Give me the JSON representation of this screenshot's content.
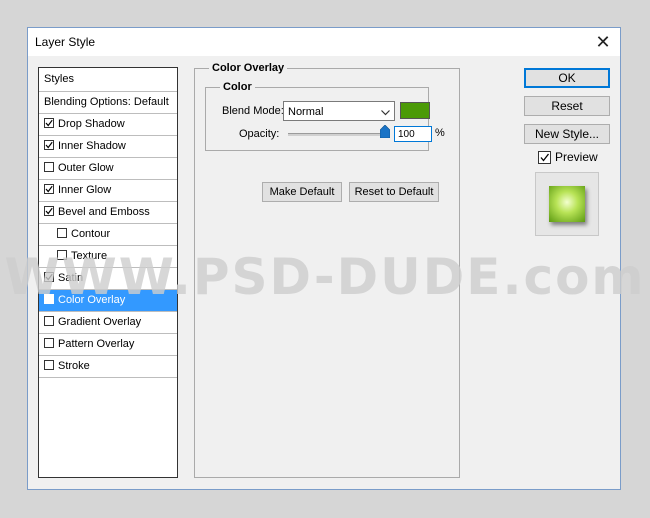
{
  "window": {
    "title": "Layer Style",
    "close_glyph": "✕"
  },
  "styles_header": "Styles",
  "blending_options": "Blending Options: Default",
  "effects": [
    {
      "label": "Drop Shadow",
      "checked": true
    },
    {
      "label": "Inner Shadow",
      "checked": true
    },
    {
      "label": "Outer Glow",
      "checked": false
    },
    {
      "label": "Inner Glow",
      "checked": true
    },
    {
      "label": "Bevel and Emboss",
      "checked": true
    },
    {
      "label": "Contour",
      "checked": false
    },
    {
      "label": "Texture",
      "checked": false
    },
    {
      "label": "Satin",
      "checked": true
    },
    {
      "label": "Color Overlay",
      "checked": true
    },
    {
      "label": "Gradient Overlay",
      "checked": false
    },
    {
      "label": "Pattern Overlay",
      "checked": false
    },
    {
      "label": "Stroke",
      "checked": false
    }
  ],
  "overlay": {
    "section_title": "Color Overlay",
    "color_group": "Color",
    "blend_mode_label": "Blend Mode:",
    "blend_mode_value": "Normal",
    "overlay_color": "#4b9a07",
    "opacity_label": "Opacity:",
    "opacity_value": "100",
    "opacity_unit": "%",
    "opacity_fraction": 1.0,
    "make_default": "Make Default",
    "reset_default": "Reset to Default"
  },
  "right_buttons": {
    "ok": "OK",
    "reset": "Reset",
    "new_style": "New Style..."
  },
  "preview": {
    "label": "Preview",
    "checked": true
  },
  "watermark": "WWW.PSD-DUDE.com"
}
